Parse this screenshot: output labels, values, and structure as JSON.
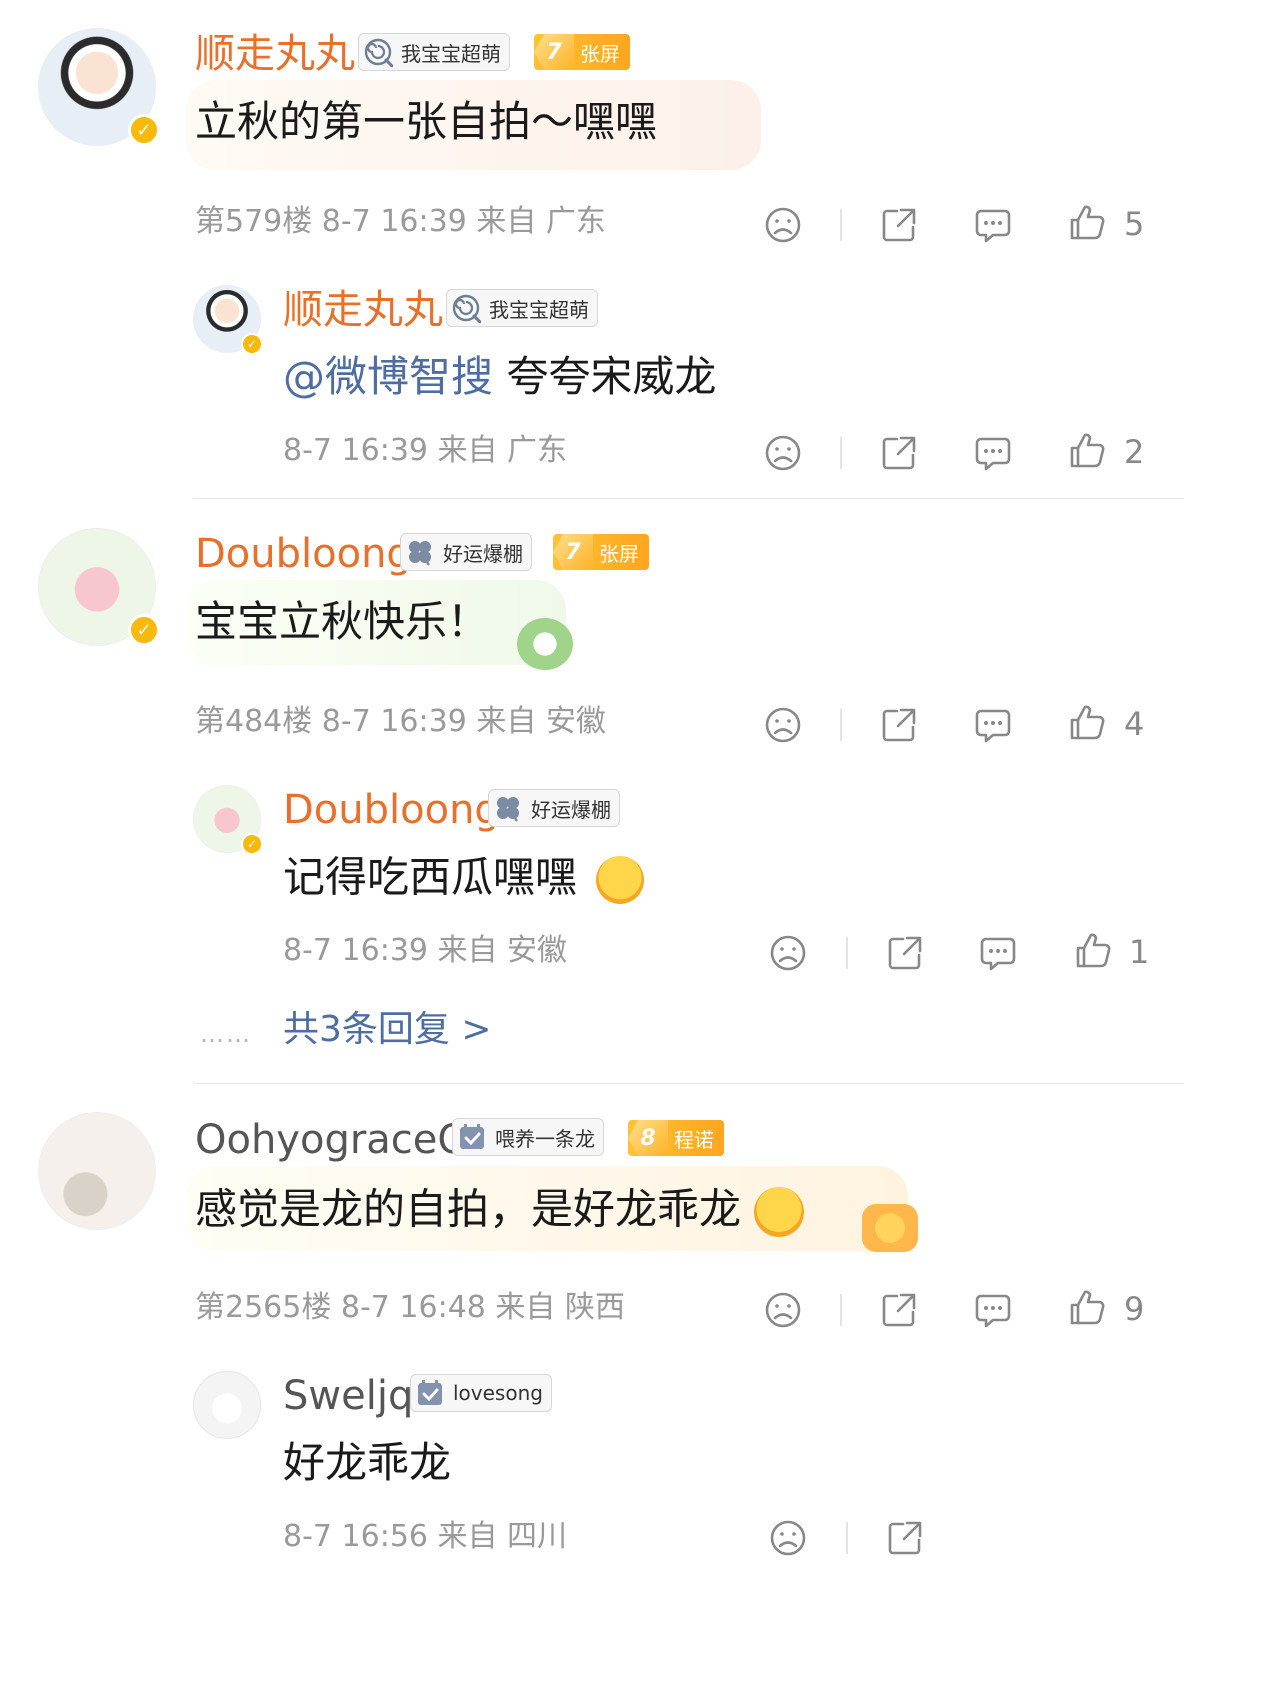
{
  "colors": {
    "username": "#e8702a",
    "meta": "#9a9a9a",
    "link": "#4e6ea2",
    "fan_badge": "#ffb229",
    "v_badge": "#f6b90c"
  },
  "comments": [
    {
      "user": "顺走丸丸",
      "tag": "我宝宝超萌",
      "fan_level": "7",
      "fan_name": "张屏",
      "text": "立秋的第一张自拍～嘿嘿",
      "meta": "第579楼 8-7 16:39 来自 广东",
      "likes": "5",
      "reply": {
        "user": "顺走丸丸",
        "tag": "我宝宝超萌",
        "mention": "@微博智搜",
        "text": " 夸夸宋威龙",
        "meta": "8-7 16:39 来自 广东",
        "likes": "2"
      }
    },
    {
      "user": "Doubloong",
      "tag": "好运爆棚",
      "fan_level": "7",
      "fan_name": "张屏",
      "text": "宝宝立秋快乐！",
      "meta": "第484楼 8-7 16:39 来自 安徽",
      "likes": "4",
      "reply": {
        "user": "Doubloong",
        "tag": "好运爆棚",
        "text": "记得吃西瓜嘿嘿",
        "meta": "8-7 16:39 来自 安徽",
        "likes": "1"
      },
      "more_replies": "共3条回复 >"
    },
    {
      "user": "OohyograceO",
      "tag": "喂养一条龙",
      "fan_level": "8",
      "fan_name": "程诺",
      "text": "感觉是龙的自拍，是好龙乖龙",
      "meta": "第2565楼 8-7 16:48 来自 陕西",
      "likes": "9",
      "reply": {
        "user": "Sweljq",
        "tag": "lovesong",
        "text": "好龙乖龙",
        "meta": "8-7 16:56 来自 四川"
      }
    }
  ],
  "icons": [
    "dislike-icon",
    "share-icon",
    "comment-icon",
    "like-icon",
    "lollipop-icon",
    "clover-icon",
    "calendar-check-icon",
    "verified-icon"
  ]
}
